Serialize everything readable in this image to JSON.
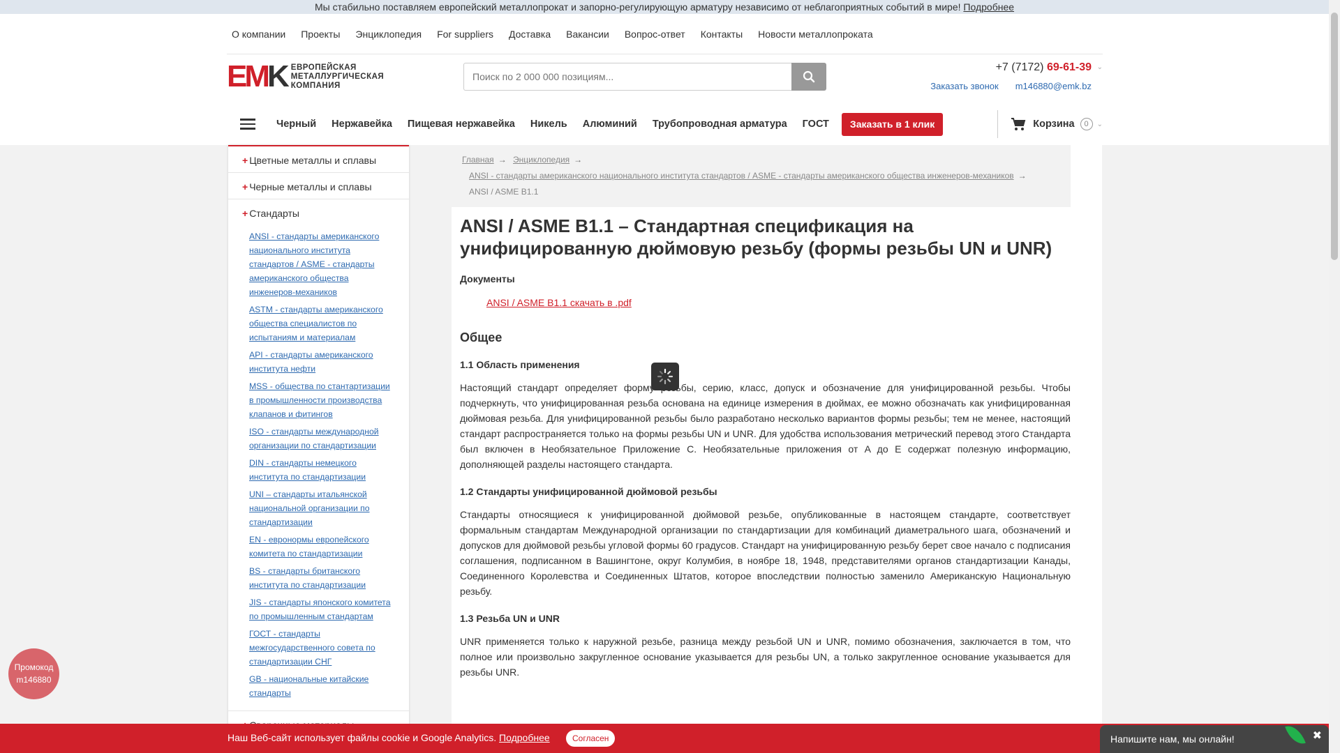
{
  "banner": {
    "text": "Мы стабильно поставляем европейский металлопрокат и запорно-регулирующую арматуру независимо от неблагоприятных событий в мире!",
    "link": "Подробнее"
  },
  "topmenu": [
    "О компании",
    "Проекты",
    "Энциклопедия",
    "For suppliers",
    "Доставка",
    "Вакансии",
    "Вопрос-ответ",
    "Контакты",
    "Новости металлопроката"
  ],
  "logo": {
    "mark_red": "EM",
    "mark_dark": "K",
    "line1": "ЕВРОПЕЙСКАЯ",
    "line2": "МЕТАЛЛУРГИЧЕСКАЯ",
    "line3": "КОМПАНИЯ"
  },
  "search": {
    "placeholder": "Поиск по 2 000 000 позициям..."
  },
  "phone": {
    "prefix": "+7 (7172) ",
    "number": "69-61-39"
  },
  "contacts": {
    "callback": "Заказать звонок",
    "email": "m146880@emk.bz"
  },
  "catnav": [
    "Черный",
    "Нержавейка",
    "Пищевая нержавейка",
    "Никель",
    "Алюминий",
    "Трубопроводная арматура",
    "ГОСТ"
  ],
  "oneclick": "Заказать в 1 клик",
  "cart": {
    "label": "Корзина",
    "count": "0"
  },
  "sidebar": {
    "sections": [
      "Цветные металлы и сплавы",
      "Черные металлы и сплавы",
      "Стандарты",
      "Сварочные материалы"
    ],
    "standards": [
      "ANSI - стандарты американского национального института стандартов / ASME - стандарты американского общества инженеров-механиков",
      "ASTM - стандарты американского общества специалистов по испытаниям и материалам",
      "API - стандарты американского института нефти",
      "MSS - общества по стантартизации в промышленности производства клапанов и фитингов",
      "ISO - стандарты международной организации по стандартизации",
      "DIN - стандарты немецкого института по стандартизации",
      "UNI – стандарты итальянской национальной организации по стандартизации",
      "EN - евронормы европейского комитета по стандартизации",
      "BS - стандарты британского института по стандартизации",
      "JIS - стандарты японского комитета по промышленным стандартам",
      "ГОСТ - стандарты межгосударственного совета по стандартизации СНГ",
      "GB - национальные китайские стандарты"
    ]
  },
  "breadcrumb": {
    "home": "Главная",
    "encyclopedia": "Энциклопедия",
    "ansi": "ANSI - стандарты американского национального института стандартов / ASME - стандарты американского общества инженеров-механиков",
    "current": "ANSI / ASME B1.1"
  },
  "article": {
    "title": "ANSI / ASME B1.1 – Стандартная спецификация на унифицированную дюймовую резьбу (формы резьбы UN и UNR)",
    "docs_heading": "Документы",
    "pdf_link": "ANSI / ASME B1.1 скачать в .pdf",
    "general_heading": "Общее",
    "s1_title": "1.1 Область применения",
    "s1_text": "Настоящий стандарт определяет форму резьбы, серию, класс, допуск и обозначение для унифицированной резьбы. Чтобы подчеркнуть, что унифицированная резьба основана на единице измерения в дюймах, ее можно обозначать как унифицированная дюймовая резьба. Для унифицированной резьбы было разработано несколько вариантов формы резьбы; тем не менее, настоящий стандарт распространяется только на формы резьбы UN и UNR. Для удобства использования метрический перевод этого Стандарта был включен в Необязательное Приложение C. Необязательные приложения от A до E содержат полезную информацию, дополняющей разделы настоящего стандарта.",
    "s2_title": "1.2 Стандарты унифицированной дюймовой резьбы",
    "s2_text": "Стандарты относящиеся к унифицированной дюймовой резьбе, опубликованные в настоящем стандарте, соответствует формальным стандартам Международной организации по стандартизации для комбинаций диаметрального шага, обозначений и допусков для дюймовой резьбы угловой формы 60 градусов. Стандарт на унифицированную резьбу берет свое начало с подписания соглашения, подписанном в Вашингтоне, округ Колумбия, в ноябре 18, 1948, представителями органов стандартизации Канады, Соединенного Королевства и Соединенных Штатов, которое впоследствии полностью заменило Американскую Национальную резьбу.",
    "s3_title": "1.3 Резьба UN и UNR",
    "s3_text": "UNR применяется только к наружной резьбе, разница между резьбой UN и UNR, помимо обозначения, заключается в том, что полное или произвольно закругленное основание указывается для резьбы UN, а только закругленное основание указывается для резьбы UNR."
  },
  "promo": {
    "line1": "Промокод",
    "line2": "m146880"
  },
  "cookie": {
    "text": "Наш Веб-сайт использует файлы cookie и Google Analytics.",
    "link": "Подробнее",
    "button": "Согласен"
  },
  "chat": {
    "text": "Напишите нам, мы онлайн!"
  },
  "colors": {
    "accent": "#d0202a",
    "link": "#2e6ab0"
  }
}
